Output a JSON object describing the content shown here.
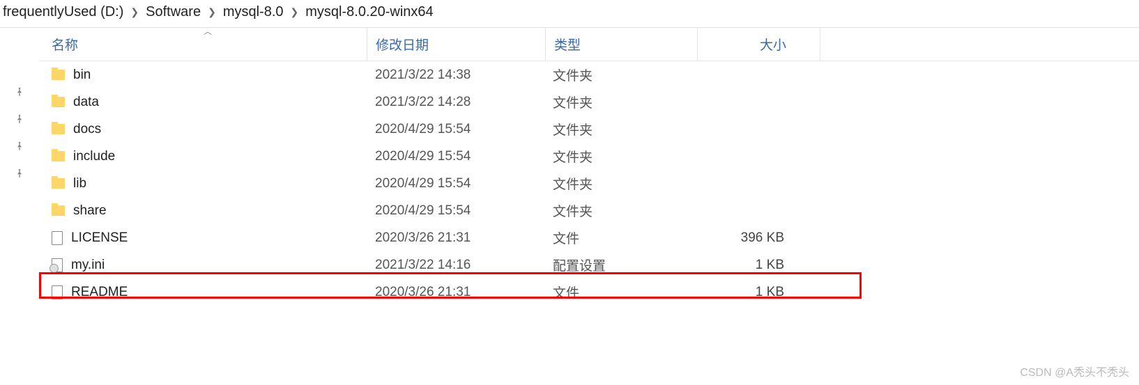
{
  "breadcrumb": [
    "frequentlyUsed (D:)",
    "Software",
    "mysql-8.0",
    "mysql-8.0.20-winx64"
  ],
  "columns": {
    "name": "名称",
    "date": "修改日期",
    "type": "类型",
    "size": "大小"
  },
  "rows": [
    {
      "icon": "folder",
      "name": "bin",
      "date": "2021/3/22 14:38",
      "type": "文件夹",
      "size": "",
      "pinned": true,
      "highlight": false
    },
    {
      "icon": "folder",
      "name": "data",
      "date": "2021/3/22 14:28",
      "type": "文件夹",
      "size": "",
      "pinned": true,
      "highlight": false
    },
    {
      "icon": "folder",
      "name": "docs",
      "date": "2020/4/29 15:54",
      "type": "文件夹",
      "size": "",
      "pinned": true,
      "highlight": false
    },
    {
      "icon": "folder",
      "name": "include",
      "date": "2020/4/29 15:54",
      "type": "文件夹",
      "size": "",
      "pinned": true,
      "highlight": false
    },
    {
      "icon": "folder",
      "name": "lib",
      "date": "2020/4/29 15:54",
      "type": "文件夹",
      "size": "",
      "pinned": false,
      "highlight": false
    },
    {
      "icon": "folder",
      "name": "share",
      "date": "2020/4/29 15:54",
      "type": "文件夹",
      "size": "",
      "pinned": false,
      "highlight": false
    },
    {
      "icon": "file",
      "name": "LICENSE",
      "date": "2020/3/26 21:31",
      "type": "文件",
      "size": "396 KB",
      "pinned": false,
      "highlight": false
    },
    {
      "icon": "ini",
      "name": "my.ini",
      "date": "2021/3/22 14:16",
      "type": "配置设置",
      "size": "1 KB",
      "pinned": false,
      "highlight": true
    },
    {
      "icon": "file",
      "name": "README",
      "date": "2020/3/26 21:31",
      "type": "文件",
      "size": "1 KB",
      "pinned": false,
      "highlight": false
    }
  ],
  "watermark": "CSDN @A秃头不秃头"
}
